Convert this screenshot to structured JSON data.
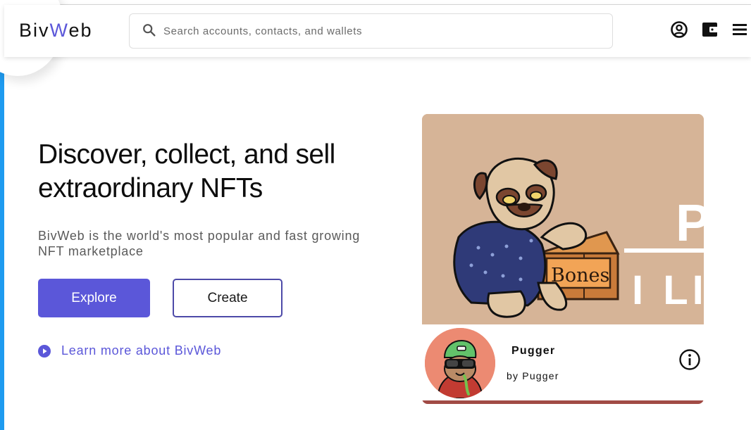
{
  "header": {
    "logo": {
      "part1": "Biv",
      "part2": "W",
      "part3": "eb"
    },
    "search": {
      "placeholder": "Search accounts, contacts, and wallets",
      "icon": "search-icon"
    },
    "icons": [
      "account-icon",
      "wallet-icon",
      "menu-icon"
    ]
  },
  "hero": {
    "title_line1": "Discover, collect, and sell",
    "title_line2": "extraordinary NFTs",
    "subtitle": "BivWeb is the world's most popular and fast growing NFT marketplace",
    "explore_label": "Explore",
    "create_label": "Create",
    "learn_more": "Learn more about BivWeb"
  },
  "nft_card": {
    "name": "Pugger",
    "by": "by Pugger",
    "art_text": {
      "box": "Bones",
      "side_top": "P",
      "side_bottom": "I LI"
    }
  },
  "colors": {
    "accent": "#5b57d9",
    "card_bg": "#d6b497",
    "avatar_bg": "#ec8a72",
    "card_bar": "#a14b45"
  }
}
